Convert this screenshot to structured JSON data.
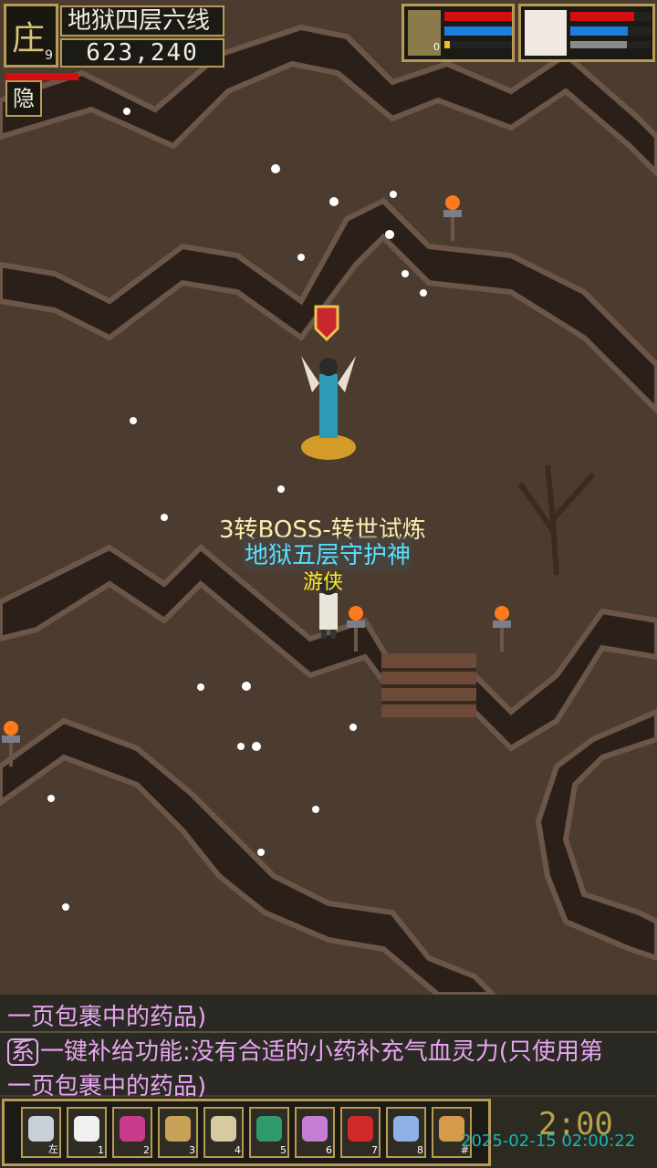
{
  "hud": {
    "avatar_glyph": "庄",
    "level": "9",
    "map_name": "地狱四层六线",
    "coords": "623,240",
    "hide_label": "隐",
    "pet_level": "0",
    "pet_hp": 1.0,
    "pet_mp": 1.0,
    "pet_exp": 0.08,
    "player_hp": 0.8,
    "player_mp": 0.72,
    "player_exp": 0.7
  },
  "labels": {
    "boss_title": "3转BOSS-转世试炼",
    "guardian_name": "地狱五层守护神",
    "player_name": "游侠"
  },
  "chat": {
    "line1": "一页包裹中的药品)",
    "line2_tag": "系",
    "line2": "一键补给功能:没有合适的小药补充气血灵力(只使用第",
    "line3": "一页包裹中的药品)"
  },
  "skills": [
    {
      "key": "左",
      "icon": "gear-icon",
      "color": "#c9d1d8"
    },
    {
      "key": "1",
      "icon": "chat-bubble-icon",
      "color": "#f0f0f0"
    },
    {
      "key": "2",
      "icon": "potion-icon",
      "color": "#c93b8a"
    },
    {
      "key": "3",
      "icon": "bag-icon",
      "color": "#c9a25a"
    },
    {
      "key": "4",
      "icon": "scroll-icon",
      "color": "#d8caa0"
    },
    {
      "key": "5",
      "icon": "card-icon",
      "color": "#2f9b6b"
    },
    {
      "key": "6",
      "icon": "team-icon",
      "color": "#c47fd2"
    },
    {
      "key": "7",
      "icon": "flag-icon",
      "color": "#d12a2a"
    },
    {
      "key": "8",
      "icon": "party-icon",
      "color": "#8fb2e6"
    },
    {
      "key": "#",
      "icon": "mount-icon",
      "color": "#d59b4a"
    }
  ],
  "clock": "2:00",
  "timestamp": "2025-02-15 02:00:22"
}
